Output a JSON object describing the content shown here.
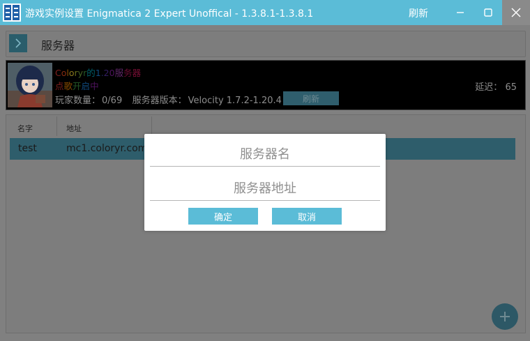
{
  "titlebar": {
    "title": "游戏实例设置 Enigmatica 2 Expert Unoffical - 1.3.8.1-1.3.8.1",
    "refresh": "刷新"
  },
  "header": {
    "title": "服务器"
  },
  "server_card": {
    "motd_line1": [
      {
        "text": "C",
        "color": "#e53935"
      },
      {
        "text": "o",
        "color": "#f4511e"
      },
      {
        "text": "l",
        "color": "#fb8c00"
      },
      {
        "text": "o",
        "color": "#fdd835"
      },
      {
        "text": "r",
        "color": "#c0ca33"
      },
      {
        "text": "y",
        "color": "#7cb342"
      },
      {
        "text": "r",
        "color": "#43a047"
      },
      {
        "text": "的",
        "color": "#00acc1"
      },
      {
        "text": "1",
        "color": "#1e88e5"
      },
      {
        "text": ".",
        "color": "#3949ab"
      },
      {
        "text": "2",
        "color": "#5e35b1"
      },
      {
        "text": "0",
        "color": "#8e24aa"
      },
      {
        "text": "服",
        "color": "#ab47bc"
      },
      {
        "text": "务",
        "color": "#c2185b"
      },
      {
        "text": "器",
        "color": "#d81b60"
      }
    ],
    "motd_line2": [
      {
        "text": "点",
        "color": "#e53935"
      },
      {
        "text": "歌",
        "color": "#fb8c00"
      },
      {
        "text": "开",
        "color": "#43a047"
      },
      {
        "text": "启",
        "color": "#1e88e5"
      },
      {
        "text": "中",
        "color": "#8e24aa"
      }
    ],
    "players_label": "玩家数量：",
    "players_value": "0/69",
    "version_label": "服务器版本：",
    "version_value": "Velocity 1.7.2-1.20.4",
    "refresh": "刷新",
    "ping_label": "延迟：",
    "ping_value": "65"
  },
  "list": {
    "columns": [
      "名字",
      "地址"
    ],
    "rows": [
      {
        "name": "test",
        "address": "mc1.coloryr.com"
      }
    ]
  },
  "dialog": {
    "name_placeholder": "服务器名",
    "address_placeholder": "服务器地址",
    "ok": "确定",
    "cancel": "取消"
  },
  "colors": {
    "accent": "#5bbcd7",
    "overlay": "#808080",
    "dialog_bg": "#ffffff"
  }
}
